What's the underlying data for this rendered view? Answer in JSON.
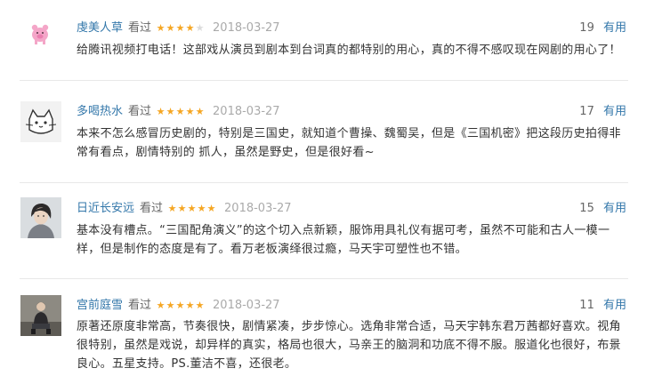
{
  "comments": [
    {
      "user": "虔美人草",
      "status": "看过",
      "rating": 4,
      "time": "2018-03-27",
      "votes": "19",
      "useful_label": "有用",
      "avatar_icon": "pink-pig-avatar",
      "text": "给腾讯视频打电话！这部戏从演员到剧本到台词真的都特别的用心，真的不得不感叹现在网剧的用心了！"
    },
    {
      "user": "多喝热水",
      "status": "看过",
      "rating": 5,
      "time": "2018-03-27",
      "votes": "17",
      "useful_label": "有用",
      "avatar_icon": "cat-doodle-avatar",
      "text": "本来不怎么感冒历史剧的，特别是三国史，就知道个曹操、魏蜀吴，但是《三国机密》把这段历史拍得非常有看点，剧情特别的 抓人，虽然是野史，但是很好看~"
    },
    {
      "user": "日近长安远",
      "status": "看过",
      "rating": 5,
      "time": "2018-03-27",
      "votes": "15",
      "useful_label": "有用",
      "avatar_icon": "portrait-woman-avatar",
      "text": "基本没有槽点。“三国配角演义”的这个切入点新颖，服饰用具礼仪有据可考，虽然不可能和古人一模一样，但是制作的态度是有了。看万老板演绎很过瘾，马天宇可塑性也不错。"
    },
    {
      "user": "宫前庭雪",
      "status": "看过",
      "rating": 5,
      "time": "2018-03-27",
      "votes": "11",
      "useful_label": "有用",
      "avatar_icon": "sitting-man-avatar",
      "text": "原著还原度非常高，节奏很快，剧情紧凑，步步惊心。选角非常合适，马天宇韩东君万茜都好喜欢。视角很特别，虽然是戏说，却异样的真实，格局也很大，马亲王的脑洞和功底不得不服。服道化也很好，布景良心。五星支持。PS.董洁不喜，还很老。"
    }
  ],
  "colors": {
    "link": "#3377aa",
    "star": "#f5a623",
    "star_off": "#dcdcdc",
    "meta": "#aaaaaa",
    "text": "#333333"
  }
}
